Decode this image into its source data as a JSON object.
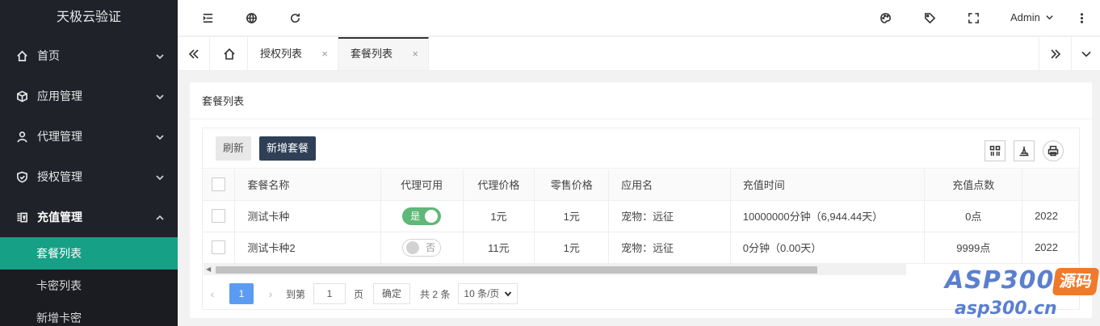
{
  "sidebar": {
    "logo": "天极云验证",
    "items": [
      {
        "label": "首页",
        "icon": "home-icon"
      },
      {
        "label": "应用管理",
        "icon": "cube-icon"
      },
      {
        "label": "代理管理",
        "icon": "user-icon"
      },
      {
        "label": "授权管理",
        "icon": "shield-icon"
      },
      {
        "label": "充值管理",
        "icon": "recharge-icon"
      }
    ],
    "subitems": [
      {
        "label": "套餐列表",
        "active": true
      },
      {
        "label": "卡密列表",
        "active": false
      },
      {
        "label": "新增卡密",
        "active": false
      }
    ]
  },
  "header": {
    "user": "Admin"
  },
  "tabs": [
    {
      "label": "授权列表",
      "close": "×"
    },
    {
      "label": "套餐列表",
      "close": "×"
    }
  ],
  "card": {
    "title": "套餐列表",
    "buttons": {
      "refresh": "刷新",
      "add": "新增套餐"
    }
  },
  "table": {
    "columns": [
      "套餐名称",
      "代理可用",
      "代理价格",
      "零售价格",
      "应用名",
      "充值时间",
      "充值点数"
    ],
    "rows": [
      {
        "name": "测试卡种",
        "agent_enabled": "是",
        "agent_price": "1元",
        "retail_price": "1元",
        "app": "宠物：远征",
        "time": "10000000分钟（6,944.44天）",
        "points": "0点",
        "date": "2022"
      },
      {
        "name": "测试卡种2",
        "agent_enabled": "否",
        "agent_price": "11元",
        "retail_price": "1元",
        "app": "宠物：远征",
        "time": "0分钟（0.00天）",
        "points": "9999点",
        "date": "2022"
      }
    ]
  },
  "pager": {
    "prev": "‹",
    "current": "1",
    "next": "›",
    "goto_label": "到第",
    "goto_value": "1",
    "page_label": "页",
    "confirm": "确定",
    "total": "共 2 条",
    "per_page": "10 条/页"
  },
  "watermark": {
    "top": "ASP300",
    "badge": "源码",
    "bottom": "asp300.cn"
  },
  "colors": {
    "sidebar_bg": "#20222a",
    "active_menu": "#16a085",
    "primary_dark": "#2f4056",
    "switch_on": "#5fb878",
    "page_current": "#5b9bf3"
  }
}
